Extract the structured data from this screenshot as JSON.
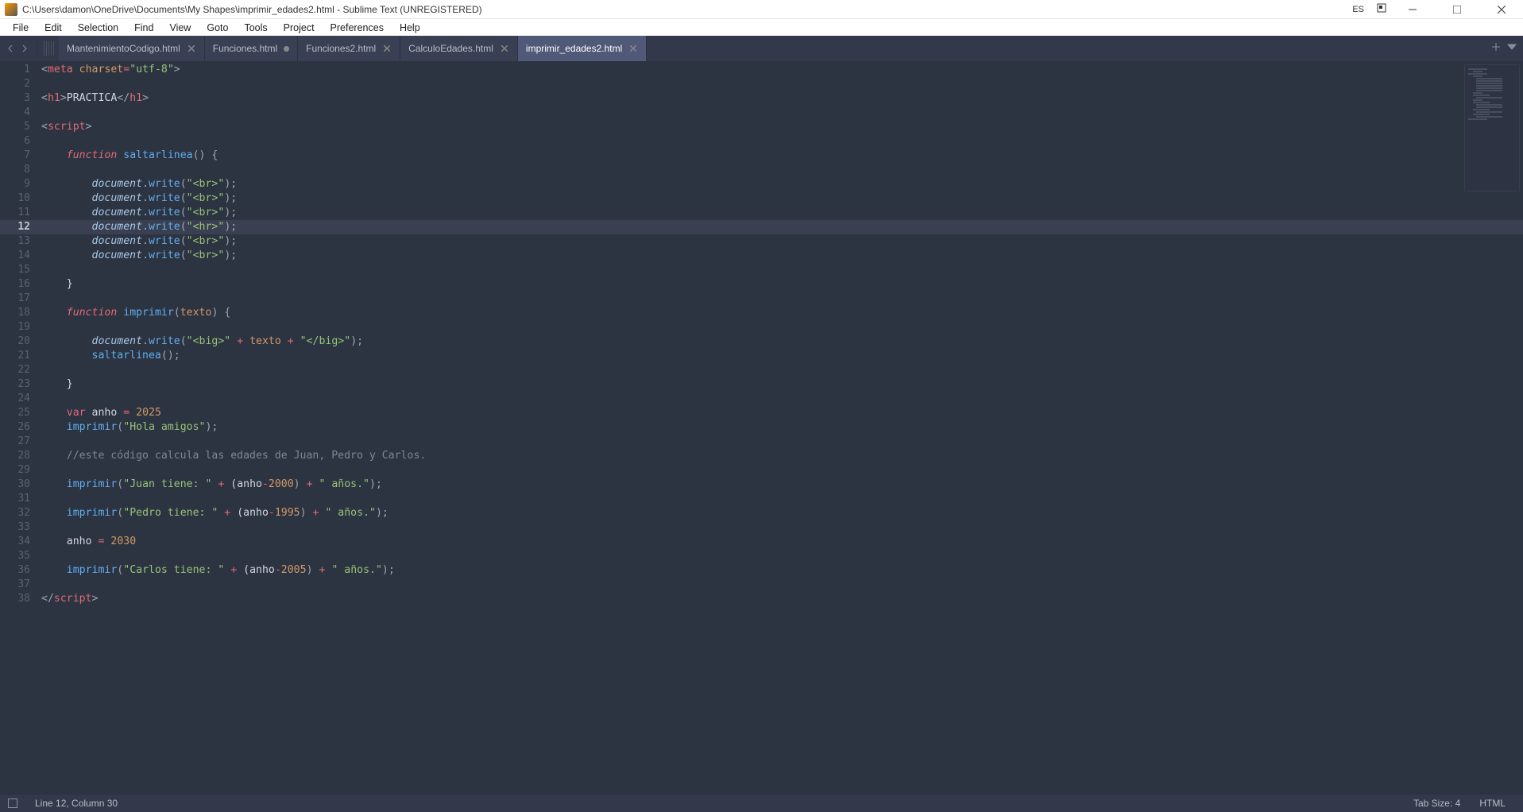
{
  "window": {
    "title": "C:\\Users\\damon\\OneDrive\\Documents\\My Shapes\\imprimir_edades2.html - Sublime Text (UNREGISTERED)",
    "language_indicator": "ES"
  },
  "menubar": [
    "File",
    "Edit",
    "Selection",
    "Find",
    "View",
    "Goto",
    "Tools",
    "Project",
    "Preferences",
    "Help"
  ],
  "tabs": [
    {
      "label": "MantenimientoCodigo.html",
      "active": false,
      "dirty": false
    },
    {
      "label": "Funciones.html",
      "active": false,
      "dirty": true
    },
    {
      "label": "Funciones2.html",
      "active": false,
      "dirty": false
    },
    {
      "label": "CalculoEdades.html",
      "active": false,
      "dirty": false
    },
    {
      "label": "imprimir_edades2.html",
      "active": true,
      "dirty": false
    }
  ],
  "editor": {
    "current_line": 12,
    "line_count": 38,
    "lines": [
      [
        [
          "pun",
          "<"
        ],
        [
          "tag",
          "meta"
        ],
        [
          "txt",
          " "
        ],
        [
          "attr",
          "charset"
        ],
        [
          "op",
          "="
        ],
        [
          "str",
          "\"utf-8\""
        ],
        [
          "pun",
          ">"
        ]
      ],
      [],
      [
        [
          "pun",
          "<"
        ],
        [
          "tag",
          "h1"
        ],
        [
          "pun",
          ">"
        ],
        [
          "txt",
          "PRACTICA"
        ],
        [
          "pun",
          "</"
        ],
        [
          "tag",
          "h1"
        ],
        [
          "pun",
          ">"
        ]
      ],
      [],
      [
        [
          "pun",
          "<"
        ],
        [
          "tag",
          "script"
        ],
        [
          "pun",
          ">"
        ]
      ],
      [],
      [
        [
          "txt",
          "    "
        ],
        [
          "key",
          "function"
        ],
        [
          "txt",
          " "
        ],
        [
          "func",
          "saltarlinea"
        ],
        [
          "pun",
          "() {"
        ]
      ],
      [],
      [
        [
          "txt",
          "        "
        ],
        [
          "obj",
          "document"
        ],
        [
          "pun",
          "."
        ],
        [
          "func",
          "write"
        ],
        [
          "pun",
          "("
        ],
        [
          "str",
          "\"<br>\""
        ],
        [
          "pun",
          ");"
        ]
      ],
      [
        [
          "txt",
          "        "
        ],
        [
          "obj",
          "document"
        ],
        [
          "pun",
          "."
        ],
        [
          "func",
          "write"
        ],
        [
          "pun",
          "("
        ],
        [
          "str",
          "\"<br>\""
        ],
        [
          "pun",
          ");"
        ]
      ],
      [
        [
          "txt",
          "        "
        ],
        [
          "obj",
          "document"
        ],
        [
          "pun",
          "."
        ],
        [
          "func",
          "write"
        ],
        [
          "pun",
          "("
        ],
        [
          "str",
          "\"<br>\""
        ],
        [
          "pun",
          ");"
        ]
      ],
      [
        [
          "txt",
          "        "
        ],
        [
          "obj",
          "document"
        ],
        [
          "pun",
          "."
        ],
        [
          "func",
          "write"
        ],
        [
          "pun",
          "("
        ],
        [
          "str",
          "\"<hr>\""
        ],
        [
          "pun",
          ");"
        ]
      ],
      [
        [
          "txt",
          "        "
        ],
        [
          "obj",
          "document"
        ],
        [
          "pun",
          "."
        ],
        [
          "func",
          "write"
        ],
        [
          "pun",
          "("
        ],
        [
          "str",
          "\"<br>\""
        ],
        [
          "pun",
          ");"
        ]
      ],
      [
        [
          "txt",
          "        "
        ],
        [
          "obj",
          "document"
        ],
        [
          "pun",
          "."
        ],
        [
          "func",
          "write"
        ],
        [
          "pun",
          "("
        ],
        [
          "str",
          "\"<br>\""
        ],
        [
          "pun",
          ");"
        ]
      ],
      [],
      [
        [
          "txt",
          "    }"
        ]
      ],
      [],
      [
        [
          "txt",
          "    "
        ],
        [
          "key",
          "function"
        ],
        [
          "txt",
          " "
        ],
        [
          "func",
          "imprimir"
        ],
        [
          "pun",
          "("
        ],
        [
          "param",
          "texto"
        ],
        [
          "pun",
          ") {"
        ]
      ],
      [],
      [
        [
          "txt",
          "        "
        ],
        [
          "obj",
          "document"
        ],
        [
          "pun",
          "."
        ],
        [
          "func",
          "write"
        ],
        [
          "pun",
          "("
        ],
        [
          "str",
          "\"<big>\""
        ],
        [
          "txt",
          " "
        ],
        [
          "op",
          "+"
        ],
        [
          "txt",
          " "
        ],
        [
          "param",
          "texto"
        ],
        [
          "txt",
          " "
        ],
        [
          "op",
          "+"
        ],
        [
          "txt",
          " "
        ],
        [
          "str",
          "\"</big>\""
        ],
        [
          "pun",
          ");"
        ]
      ],
      [
        [
          "txt",
          "        "
        ],
        [
          "func",
          "saltarlinea"
        ],
        [
          "pun",
          "();"
        ]
      ],
      [],
      [
        [
          "txt",
          "    }"
        ]
      ],
      [],
      [
        [
          "txt",
          "    "
        ],
        [
          "key2",
          "var"
        ],
        [
          "txt",
          " anho "
        ],
        [
          "op",
          "="
        ],
        [
          "txt",
          " "
        ],
        [
          "num",
          "2025"
        ]
      ],
      [
        [
          "txt",
          "    "
        ],
        [
          "func",
          "imprimir"
        ],
        [
          "pun",
          "("
        ],
        [
          "str",
          "\"Hola amigos\""
        ],
        [
          "pun",
          ");"
        ]
      ],
      [],
      [
        [
          "txt",
          "    "
        ],
        [
          "cmt",
          "//este código calcula las edades de Juan, Pedro y Carlos."
        ]
      ],
      [],
      [
        [
          "txt",
          "    "
        ],
        [
          "func",
          "imprimir"
        ],
        [
          "pun",
          "("
        ],
        [
          "str",
          "\"Juan tiene: \""
        ],
        [
          "txt",
          " "
        ],
        [
          "op",
          "+"
        ],
        [
          "txt",
          " (anho"
        ],
        [
          "op",
          "-"
        ],
        [
          "num",
          "2000"
        ],
        [
          "pun",
          ")"
        ],
        [
          "txt",
          " "
        ],
        [
          "op",
          "+"
        ],
        [
          "txt",
          " "
        ],
        [
          "str",
          "\" años.\""
        ],
        [
          "pun",
          ");"
        ]
      ],
      [],
      [
        [
          "txt",
          "    "
        ],
        [
          "func",
          "imprimir"
        ],
        [
          "pun",
          "("
        ],
        [
          "str",
          "\"Pedro tiene: \""
        ],
        [
          "txt",
          " "
        ],
        [
          "op",
          "+"
        ],
        [
          "txt",
          " (anho"
        ],
        [
          "op",
          "-"
        ],
        [
          "num",
          "1995"
        ],
        [
          "pun",
          ")"
        ],
        [
          "txt",
          " "
        ],
        [
          "op",
          "+"
        ],
        [
          "txt",
          " "
        ],
        [
          "str",
          "\" años.\""
        ],
        [
          "pun",
          ");"
        ]
      ],
      [],
      [
        [
          "txt",
          "    anho "
        ],
        [
          "op",
          "="
        ],
        [
          "txt",
          " "
        ],
        [
          "num",
          "2030"
        ]
      ],
      [],
      [
        [
          "txt",
          "    "
        ],
        [
          "func",
          "imprimir"
        ],
        [
          "pun",
          "("
        ],
        [
          "str",
          "\"Carlos tiene: \""
        ],
        [
          "txt",
          " "
        ],
        [
          "op",
          "+"
        ],
        [
          "txt",
          " (anho"
        ],
        [
          "op",
          "-"
        ],
        [
          "num",
          "2005"
        ],
        [
          "pun",
          ")"
        ],
        [
          "txt",
          " "
        ],
        [
          "op",
          "+"
        ],
        [
          "txt",
          " "
        ],
        [
          "str",
          "\" años.\""
        ],
        [
          "pun",
          ");"
        ]
      ],
      [],
      [
        [
          "pun",
          "</"
        ],
        [
          "tag",
          "script"
        ],
        [
          "pun",
          ">"
        ]
      ]
    ]
  },
  "statusbar": {
    "cursor": "Line 12, Column 30",
    "tab_size": "Tab Size: 4",
    "syntax": "HTML"
  }
}
